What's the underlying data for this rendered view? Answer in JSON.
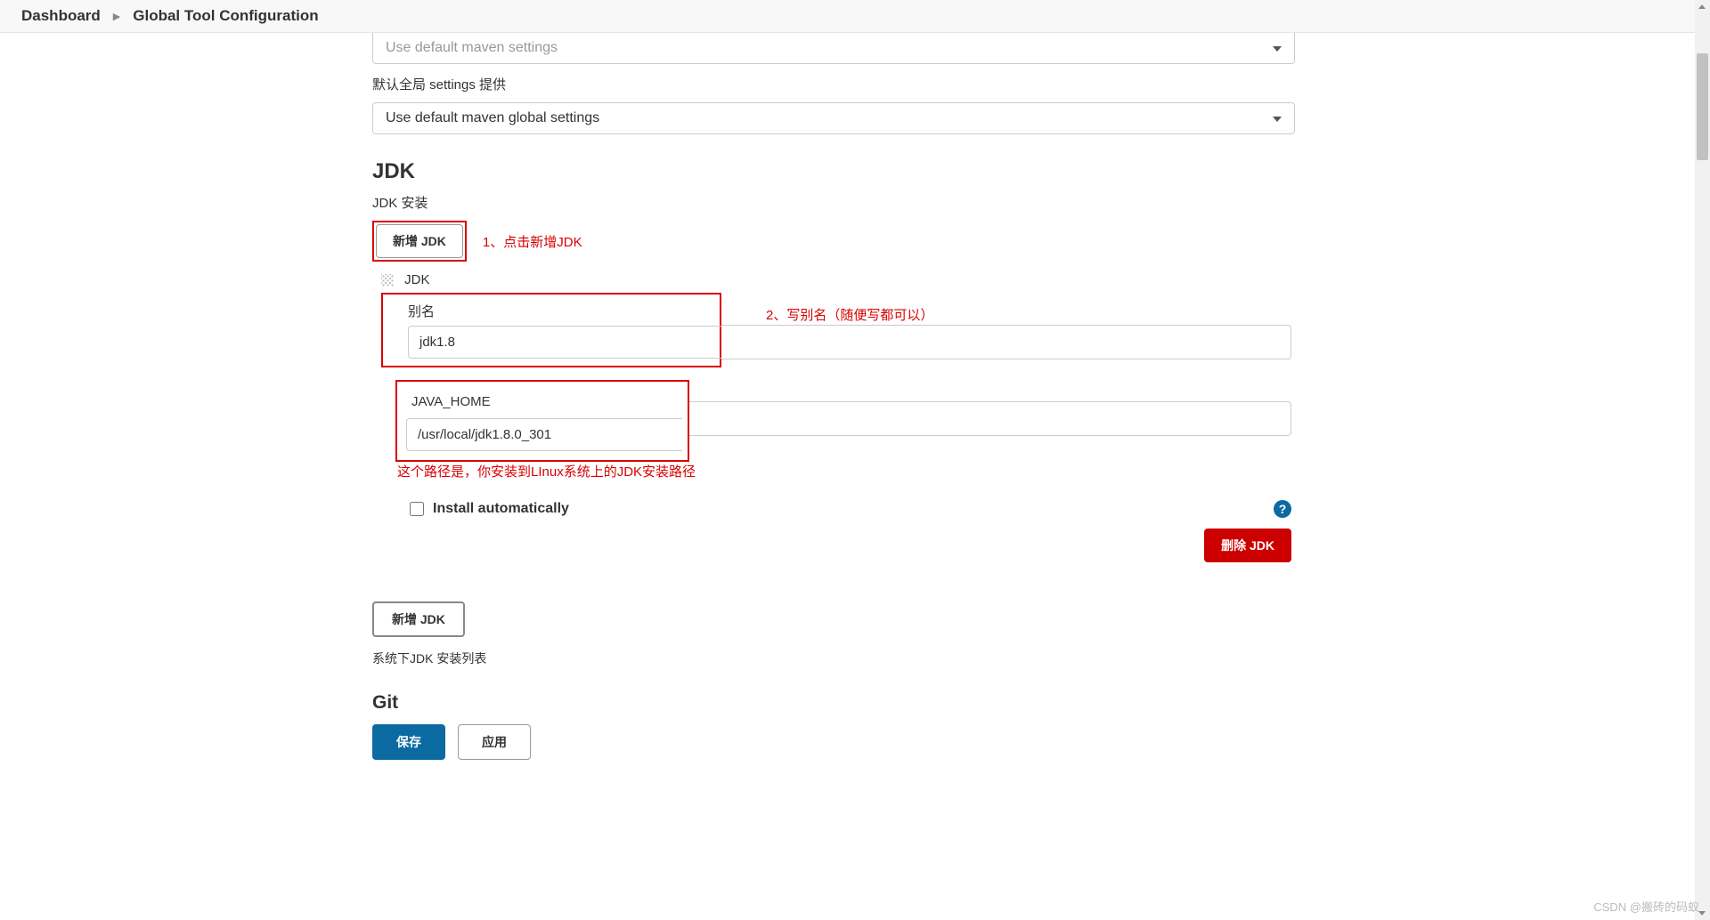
{
  "breadcrumb": {
    "dashboard": "Dashboard",
    "current": "Global Tool Configuration"
  },
  "maven": {
    "select1_value": "Use default maven settings",
    "global_settings_label": "默认全局 settings 提供",
    "select2_value": "Use default maven global settings"
  },
  "jdk": {
    "heading": "JDK",
    "install_label": "JDK 安装",
    "add_button": "新增 JDK",
    "ann1": "1、点击新增JDK",
    "entry_title": "JDK",
    "alias_label": "别名",
    "alias_value": "jdk1.8",
    "ann2": "2、写别名（随便写都可以）",
    "java_home_label": "JAVA_HOME",
    "java_home_value": "/usr/local/jdk1.8.0_301",
    "ann3": "这个路径是，你安装到LInux系统上的JDK安装路径",
    "install_auto_label": "Install automatically",
    "delete_button": "删除 JDK",
    "add_button2": "新增 JDK",
    "list_helper": "系统下JDK 安装列表"
  },
  "git": {
    "heading": "Git"
  },
  "footer": {
    "save": "保存",
    "apply": "应用"
  },
  "watermark": "CSDN @搬砖的码蚁"
}
